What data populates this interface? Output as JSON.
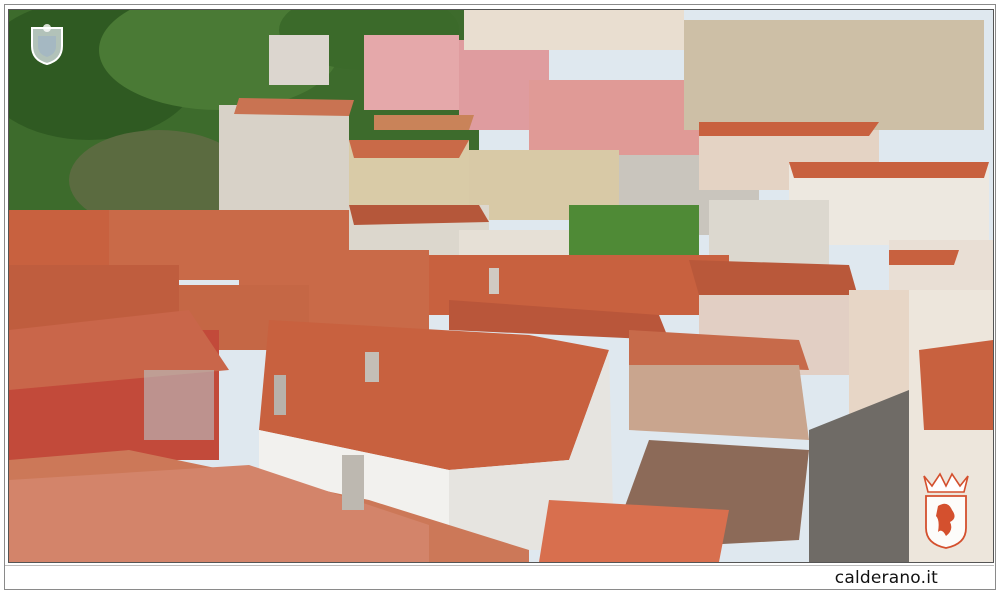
{
  "photo": {
    "subject": "rooftops",
    "palette": {
      "roof": "#c8613f",
      "roof_dark": "#a9472c",
      "wall_light": "#ece7df",
      "wall_pink": "#e6a6a8",
      "wall_beige": "#d7c9ab",
      "foliage": "#3d6b2c",
      "sky": "#dfe8ef"
    }
  },
  "caption": {
    "site": "calderano.it"
  },
  "watermarks": {
    "top_left": "municipal-crest-icon",
    "bottom_right": "coat-of-arms-icon"
  }
}
